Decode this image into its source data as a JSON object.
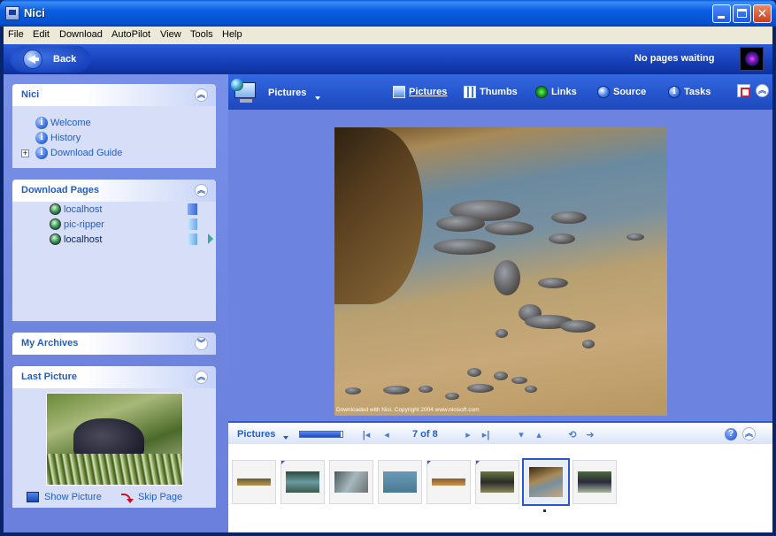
{
  "window": {
    "title": "Nici"
  },
  "menu": [
    "File",
    "Edit",
    "Download",
    "AutoPilot",
    "View",
    "Tools",
    "Help"
  ],
  "backbar": {
    "back_label": "Back",
    "status": "No pages waiting"
  },
  "panels": {
    "nici": {
      "title": "Nici",
      "items": [
        "Welcome",
        "History",
        "Download Guide"
      ]
    },
    "download_pages": {
      "title": "Download Pages",
      "items": [
        "localhost",
        "pic-ripper",
        "localhost"
      ]
    },
    "my_archives": {
      "title": "My Archives"
    },
    "last_picture": {
      "title": "Last Picture",
      "show_label": "Show Picture",
      "skip_label": "Skip Page"
    }
  },
  "toolbar": {
    "view_title": "Pictures",
    "links": [
      "Pictures",
      "Thumbs",
      "Links",
      "Source",
      "Tasks"
    ]
  },
  "main_picture": {
    "caption": "Downloaded with Nici. Copyright 2004 www.nicisoft.com"
  },
  "strip": {
    "title": "Pictures",
    "counter": "7 of 8",
    "slider_fraction": 0.95,
    "selected_index": 6
  },
  "colors": {
    "accent": "#215dc6",
    "pane_bg": "#6c84e0",
    "titlebar": "#0b5ee0"
  }
}
